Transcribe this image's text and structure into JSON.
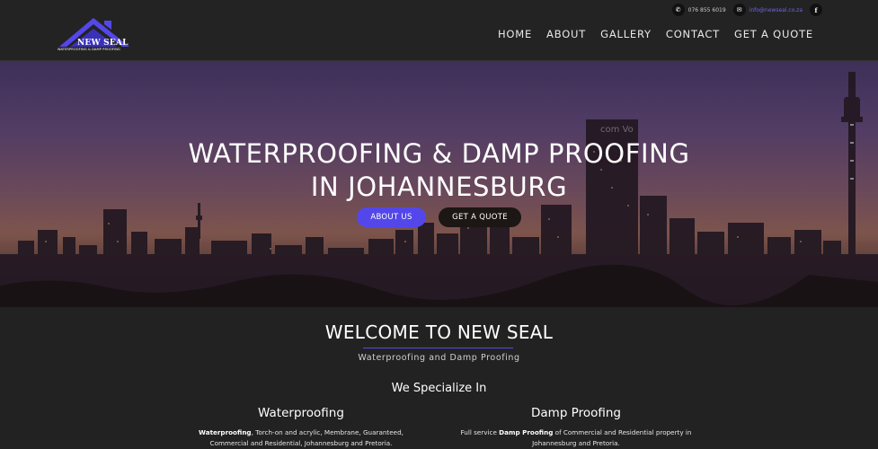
{
  "topbar": {
    "phone": "076 855 6019",
    "email": "info@newseal.co.za",
    "facebook_glyph": "f"
  },
  "logo": {
    "name": "NEW SEAL",
    "tagline": "WATERPROOFING & DAMP PROOFING",
    "roof_color": "#5447ea"
  },
  "nav": {
    "items": [
      "HOME",
      "ABOUT",
      "GALLERY",
      "CONTACT",
      "GET A QUOTE"
    ]
  },
  "hero": {
    "title_line1": "WATERPROOFING & DAMP PROOFING",
    "title_line2": "IN JOHANNESBURG",
    "about_button": "ABOUT US",
    "quote_button": "GET A QUOTE",
    "skyline_sign": "com Vo"
  },
  "welcome": {
    "title": "WELCOME TO NEW SEAL",
    "subtitle": "Waterproofing and Damp Proofing",
    "specialize": "We Specialize In",
    "col1": {
      "heading": "Waterproofing",
      "bold": "Waterproofing",
      "text": ", Torch-on and acrylic, Membrane, Guaranteed, Commercial and Residential, Johannesburg and Pretoria."
    },
    "col2": {
      "heading": "Damp Proofing",
      "pre": "Full service ",
      "bold": "Damp Proofing",
      "post": " of Commercial and Residential property in Johannesburg and Pretoria."
    }
  },
  "colors": {
    "accent": "#5447ea",
    "background": "#222222",
    "dark_button": "#1c1614"
  }
}
